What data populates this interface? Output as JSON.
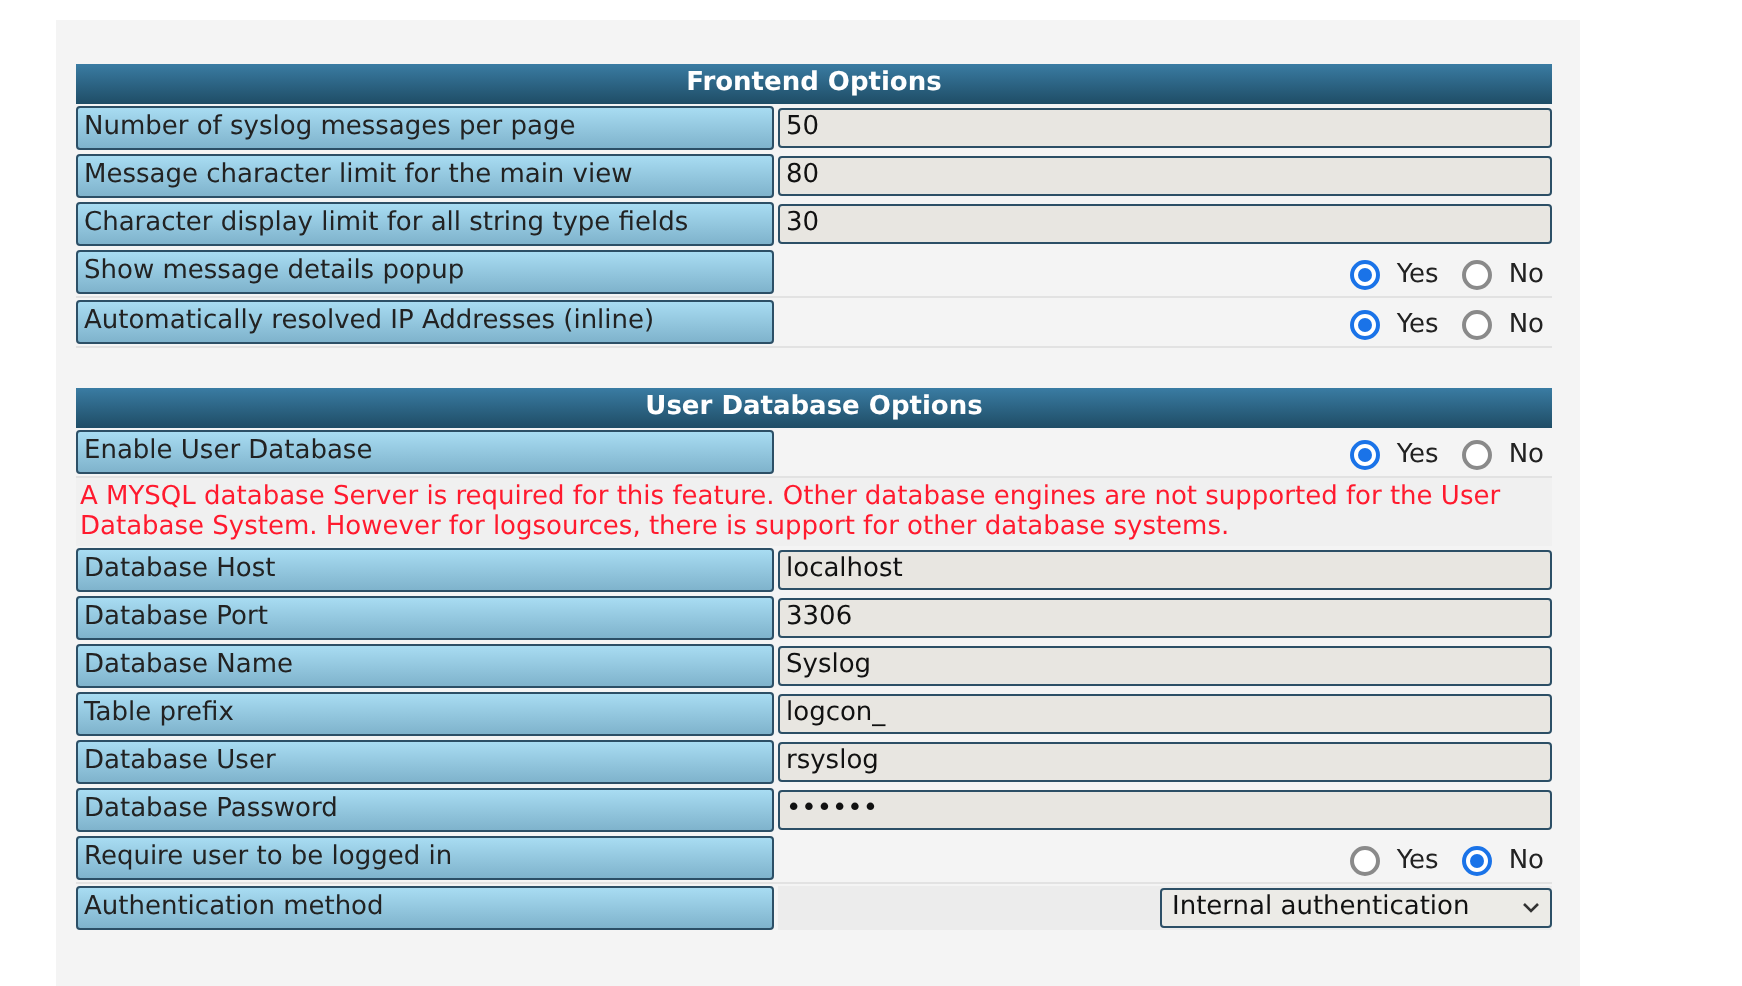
{
  "sections": [
    {
      "title": "Frontend Options",
      "rows": [
        {
          "kind": "text",
          "label": "Number of syslog messages per page",
          "value": "50"
        },
        {
          "kind": "text",
          "label": "Message character limit for the main view",
          "value": "80"
        },
        {
          "kind": "text",
          "label": "Character display limit for all string type fields",
          "value": "30"
        },
        {
          "kind": "radio",
          "label": "Show message details popup",
          "options": [
            {
              "label": "Yes",
              "selected": true
            },
            {
              "label": "No",
              "selected": false
            }
          ]
        },
        {
          "kind": "radio",
          "label": "Automatically resolved IP Addresses (inline)",
          "options": [
            {
              "label": "Yes",
              "selected": true
            },
            {
              "label": "No",
              "selected": false
            }
          ]
        },
        {
          "kind": "spacer"
        }
      ]
    },
    {
      "title": "User Database Options",
      "rows": [
        {
          "kind": "radio",
          "label": "Enable User Database",
          "options": [
            {
              "label": "Yes",
              "selected": true
            },
            {
              "label": "No",
              "selected": false
            }
          ]
        },
        {
          "kind": "note",
          "text": "A MYSQL database Server is required for this feature. Other database engines are not supported for the User Database System. However for logsources, there is support for other database systems."
        },
        {
          "kind": "text",
          "label": "Database Host",
          "value": "localhost"
        },
        {
          "kind": "text",
          "label": "Database Port",
          "value": "3306"
        },
        {
          "kind": "text",
          "label": "Database Name",
          "value": "Syslog"
        },
        {
          "kind": "text",
          "label": "Table prefix",
          "value": "logcon_"
        },
        {
          "kind": "text",
          "label": "Database User",
          "value": "rsyslog"
        },
        {
          "kind": "text",
          "label": "Database Password",
          "value": "••••••"
        },
        {
          "kind": "radio",
          "label": "Require user to be logged in",
          "options": [
            {
              "label": "Yes",
              "selected": false
            },
            {
              "label": "No",
              "selected": true
            }
          ]
        },
        {
          "kind": "select",
          "label": "Authentication method",
          "value": "Internal authentication"
        }
      ]
    }
  ]
}
